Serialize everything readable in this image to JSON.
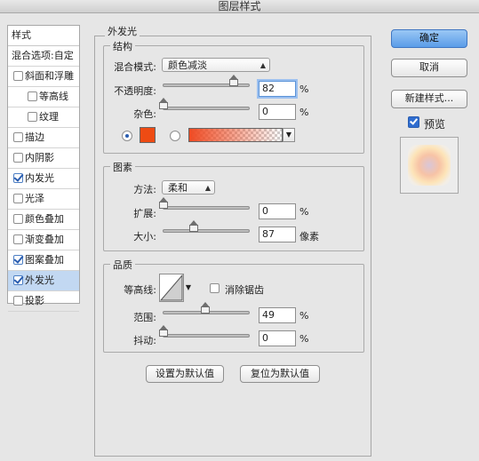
{
  "window": {
    "title": "图层样式"
  },
  "left_panel": {
    "header": "样式",
    "items": [
      {
        "label": "混合选项:自定",
        "checkbox": false,
        "checked": false,
        "indent": 0,
        "selected": false
      },
      {
        "label": "斜面和浮雕",
        "checkbox": true,
        "checked": false,
        "indent": 0,
        "selected": false
      },
      {
        "label": "等高线",
        "checkbox": true,
        "checked": false,
        "indent": 1,
        "selected": false
      },
      {
        "label": "纹理",
        "checkbox": true,
        "checked": false,
        "indent": 1,
        "selected": false
      },
      {
        "label": "描边",
        "checkbox": true,
        "checked": false,
        "indent": 0,
        "selected": false
      },
      {
        "label": "内阴影",
        "checkbox": true,
        "checked": false,
        "indent": 0,
        "selected": false
      },
      {
        "label": "内发光",
        "checkbox": true,
        "checked": true,
        "indent": 0,
        "selected": false
      },
      {
        "label": "光泽",
        "checkbox": true,
        "checked": false,
        "indent": 0,
        "selected": false
      },
      {
        "label": "颜色叠加",
        "checkbox": true,
        "checked": false,
        "indent": 0,
        "selected": false
      },
      {
        "label": "渐变叠加",
        "checkbox": true,
        "checked": false,
        "indent": 0,
        "selected": false
      },
      {
        "label": "图案叠加",
        "checkbox": true,
        "checked": true,
        "indent": 0,
        "selected": false
      },
      {
        "label": "外发光",
        "checkbox": true,
        "checked": true,
        "indent": 0,
        "selected": true
      },
      {
        "label": "投影",
        "checkbox": true,
        "checked": false,
        "indent": 0,
        "selected": false
      }
    ]
  },
  "outer_glow": {
    "title": "外发光",
    "structure": {
      "title": "结构",
      "blend_mode_label": "混合模式:",
      "blend_mode_value": "颜色减淡",
      "opacity_label": "不透明度:",
      "opacity_value": "82",
      "opacity_unit": "%",
      "opacity_level": 0.82,
      "noise_label": "杂色:",
      "noise_value": "0",
      "noise_unit": "%",
      "noise_level": 0,
      "glow_color": "#ee4b13",
      "gradient_start": "#ef4b23"
    },
    "elements": {
      "title": "图素",
      "technique_label": "方法:",
      "technique_value": "柔和",
      "spread_label": "扩展:",
      "spread_value": "0",
      "spread_unit": "%",
      "spread_level": 0,
      "size_label": "大小:",
      "size_value": "87",
      "size_unit": "像素",
      "size_level": 0.35
    },
    "quality": {
      "title": "品质",
      "contour_label": "等高线:",
      "anti_alias_label": "消除锯齿",
      "anti_alias_checked": false,
      "range_label": "范围:",
      "range_value": "49",
      "range_unit": "%",
      "range_level": 0.49,
      "jitter_label": "抖动:",
      "jitter_value": "0",
      "jitter_unit": "%",
      "jitter_level": 0
    },
    "make_default_label": "设置为默认值",
    "reset_default_label": "复位为默认值"
  },
  "right_panel": {
    "ok_label": "确定",
    "cancel_label": "取消",
    "new_style_label": "新建样式...",
    "preview_label": "预览",
    "preview_checked": true
  }
}
